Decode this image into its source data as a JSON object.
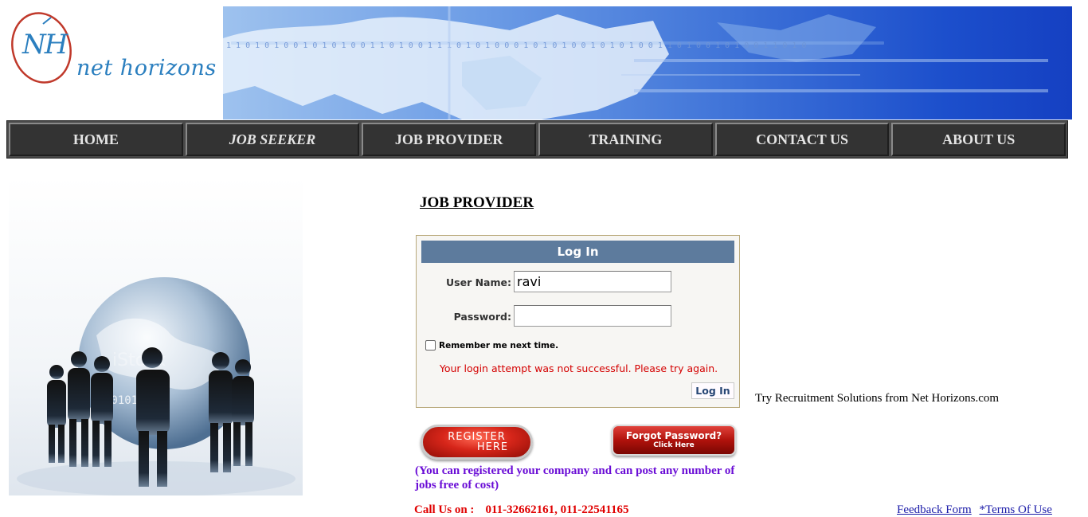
{
  "header": {
    "logo_monogram": "NH",
    "logo_text": "net horizons"
  },
  "nav": {
    "items": [
      {
        "label": "HOME"
      },
      {
        "label": "JOB SEEKER"
      },
      {
        "label": "JOB PROVIDER"
      },
      {
        "label": "TRAINING"
      },
      {
        "label": "CONTACT US"
      },
      {
        "label": "ABOUT US"
      }
    ],
    "active_index": 1
  },
  "main": {
    "heading": "JOB PROVIDER",
    "login": {
      "title": "Log In",
      "username_label": "User Name:",
      "username_value": "ravi",
      "password_label": "Password:",
      "password_value": "",
      "remember_label": "Remember me next time.",
      "remember_checked": false,
      "error_text": "Your login attempt was not successful. Please try again.",
      "button_label": "Log In"
    },
    "promo_text": "Try Recruitment Solutions from Net Horizons.com",
    "register_button": {
      "line1": "REGISTER",
      "line2": "HERE"
    },
    "forgot_button": {
      "line1": "Forgot Password?",
      "line2": "Click Here"
    },
    "register_note": "(You can registered your company and can post any number of jobs free of cost)"
  },
  "footer": {
    "call_label": "Call Us on :",
    "phone_numbers": "011-32662161, 011-22541165",
    "links": [
      "Feedback Form",
      "*Terms Of Use"
    ]
  },
  "colors": {
    "nav_bg": "#333333",
    "login_header": "#5d7b9d",
    "error": "#d40000",
    "note": "#6a0dd6",
    "call": "#e00000",
    "link": "#1a1aa8"
  }
}
